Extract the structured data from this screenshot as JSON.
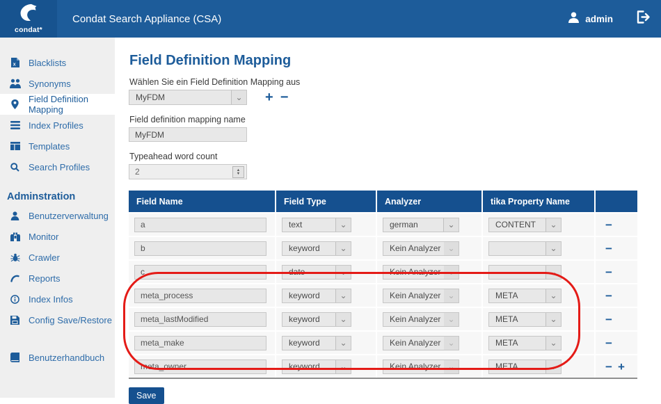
{
  "colors": {
    "header_blue": "#1d5c9a",
    "logo_blue": "#17538f",
    "table_header_blue": "#15508f",
    "sidebar_bg": "#efefef",
    "link_blue": "#2e6ca9",
    "annotation_red": "#e41b17"
  },
  "icons": {
    "chevron": "⌄",
    "minus": "−",
    "plus": "+",
    "spinner_up": "▲",
    "spinner_down": "▼"
  },
  "header": {
    "logo_text": "condat*",
    "title": "Condat Search Appliance (CSA)",
    "user_name": "admin"
  },
  "sidebar": {
    "items": [
      {
        "label": "Blacklists",
        "icon": "blacklist-file-icon",
        "active": false
      },
      {
        "label": "Synonyms",
        "icon": "synonyms-people-icon",
        "active": false
      },
      {
        "label": "Field Definition Mapping",
        "icon": "map-marker-icon",
        "active": true
      },
      {
        "label": "Index Profiles",
        "icon": "list-bars-icon",
        "active": false
      },
      {
        "label": "Templates",
        "icon": "templates-columns-icon",
        "active": false
      },
      {
        "label": "Search Profiles",
        "icon": "search-icon",
        "active": false
      }
    ],
    "admin_header": "Adminstration",
    "admin_items": [
      {
        "label": "Benutzerverwaltung",
        "icon": "user-icon"
      },
      {
        "label": "Monitor",
        "icon": "binoculars-icon"
      },
      {
        "label": "Crawler",
        "icon": "bug-icon"
      },
      {
        "label": "Reports",
        "icon": "chart-curve-icon"
      },
      {
        "label": "Index Infos",
        "icon": "info-circle-icon"
      },
      {
        "label": "Config Save/Restore",
        "icon": "save-icon"
      }
    ],
    "manual_item": {
      "label": "Benutzerhandbuch",
      "icon": "book-icon"
    }
  },
  "main": {
    "page_title": "Field Definition Mapping",
    "fdm_select": {
      "label": "Wählen Sie ein Field Definition Mapping aus",
      "value": "MyFDM"
    },
    "name_field": {
      "label": "Field definition mapping name",
      "value": "MyFDM"
    },
    "typeahead_field": {
      "label": "Typeahead word count",
      "value": "2"
    },
    "table": {
      "headers": [
        "Field Name",
        "Field Type",
        "Analyzer",
        "tika Property Name",
        ""
      ],
      "no_analyzer_label": "Kein Analyzer",
      "rows": [
        {
          "field_name": "a",
          "field_type": "text",
          "analyzer": "german",
          "tika": "CONTENT"
        },
        {
          "field_name": "b",
          "field_type": "keyword",
          "analyzer": "Kein Analyzer",
          "tika": ""
        },
        {
          "field_name": "c",
          "field_type": "date",
          "analyzer": "Kein Analyzer",
          "tika": ""
        },
        {
          "field_name": "meta_process",
          "field_type": "keyword",
          "analyzer": "Kein Analyzer",
          "tika": "META"
        },
        {
          "field_name": "meta_lastModified",
          "field_type": "keyword",
          "analyzer": "Kein Analyzer",
          "tika": "META"
        },
        {
          "field_name": "meta_make",
          "field_type": "keyword",
          "analyzer": "Kein Analyzer",
          "tika": "META"
        },
        {
          "field_name": "meta_owner",
          "field_type": "keyword",
          "analyzer": "Kein Analyzer",
          "tika": "META"
        }
      ]
    },
    "save_label": "Save"
  }
}
